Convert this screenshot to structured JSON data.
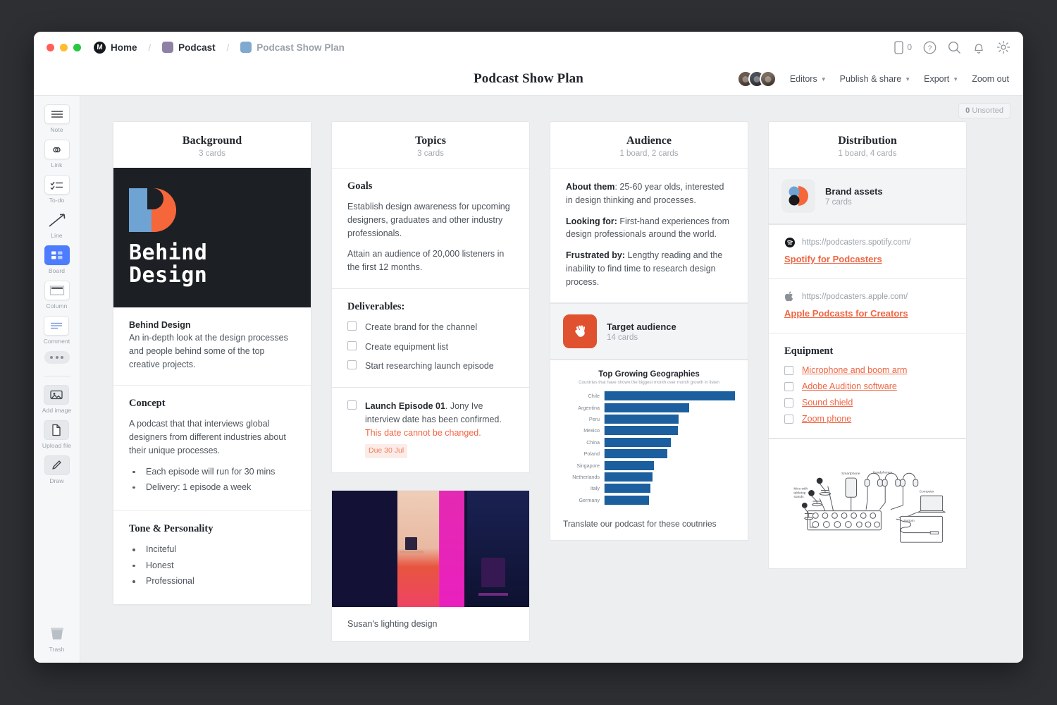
{
  "titlebar": {
    "breadcrumb": [
      {
        "label": "Home",
        "icon": "milanote-logo-icon"
      },
      {
        "label": "Podcast",
        "icon": "purple-board-icon"
      },
      {
        "label": "Podcast Show Plan",
        "icon": "blue-board-icon"
      }
    ],
    "separator": "/",
    "mobile_count": "0",
    "icons": [
      "mobile-icon",
      "help-icon",
      "search-icon",
      "notification-icon",
      "settings-icon"
    ]
  },
  "header": {
    "title": "Podcast Show Plan",
    "editors_label": "Editors",
    "publish_label": "Publish & share",
    "export_label": "Export",
    "zoom_label": "Zoom out"
  },
  "sidebar": {
    "items": [
      {
        "label": "Note",
        "icon": "note-icon"
      },
      {
        "label": "Link",
        "icon": "link-icon"
      },
      {
        "label": "To-do",
        "icon": "todo-icon"
      },
      {
        "label": "Line",
        "icon": "line-icon"
      },
      {
        "label": "Board",
        "icon": "board-icon"
      },
      {
        "label": "Column",
        "icon": "column-icon"
      },
      {
        "label": "Comment",
        "icon": "comment-icon"
      }
    ],
    "more_icon": "more-dots-icon",
    "file_items": [
      {
        "label": "Add image",
        "icon": "add-image-icon"
      },
      {
        "label": "Upload file",
        "icon": "upload-file-icon"
      },
      {
        "label": "Draw",
        "icon": "draw-icon"
      }
    ],
    "trash": {
      "label": "Trash",
      "icon": "trash-icon"
    }
  },
  "canvas": {
    "unsorted_count": "0",
    "unsorted_label": "Unsorted"
  },
  "columns": [
    {
      "title": "Background",
      "subtitle": "3 cards",
      "brand_image": {
        "wordmark_line1": "Behind",
        "wordmark_line2": "Design",
        "bg_color": "#1c2024",
        "blue": "#6ea3d4",
        "orange": "#f5673b"
      },
      "cards": [
        {
          "heading": "Behind Design",
          "body": "An in-depth look at the design processes and people behind some of the top creative projects."
        },
        {
          "title": "Concept",
          "body": "A podcast that that interviews global designers from different industries about their unique processes.",
          "bullets": [
            "Each episode will run for 30 mins",
            "Delivery: 1 episode a week"
          ]
        },
        {
          "title": "Tone & Personality",
          "bullets": [
            "Inciteful",
            "Honest",
            "Professional"
          ]
        }
      ]
    },
    {
      "title": "Topics",
      "subtitle": "3 cards",
      "goals": {
        "title": "Goals",
        "p1": "Establish design awareness for upcoming designers, graduates and other industry professionals.",
        "p2": "Attain an audience of 20,000 listeners in the first 12 months."
      },
      "deliverables": {
        "title": "Deliverables:",
        "items": [
          "Create brand for the channel",
          "Create equipment list",
          "Start researching launch episode"
        ]
      },
      "launch": {
        "bold": "Launch Episode 01",
        "rest": ". Jony Ive interview date has been confirmed.",
        "warning": "This date cannot be changed.",
        "due": "Due 30 Jul"
      },
      "photo_caption": "Susan's lighting design"
    },
    {
      "title": "Audience",
      "subtitle": "1 board, 2 cards",
      "about": [
        {
          "label": "About them",
          "sep": ": ",
          "text": "25-60 year olds, interested in design thinking and processes."
        },
        {
          "label": "Looking for:",
          "sep": " ",
          "text": "First-hand experiences from design professionals around the world."
        },
        {
          "label": "Frustrated by:",
          "sep": " ",
          "text": "Lengthy reading and the inability to find time to research design process."
        }
      ],
      "board": {
        "name": "Target audience",
        "sub": "14 cards",
        "icon": "clapping-hands-icon",
        "color": "#e0522f"
      },
      "chart_note": "Translate our podcast for these coutnries"
    },
    {
      "title": "Distribution",
      "subtitle": "1 board, 4 cards",
      "board": {
        "name": "Brand assets",
        "sub": "7 cards",
        "icon": "brand-assets-icon"
      },
      "links": [
        {
          "url": "https://podcasters.spotify.com/",
          "title": "Spotify for Podcasters",
          "icon": "spotify-icon"
        },
        {
          "url": "https://podcasters.apple.com/",
          "title": "Apple Podcasts for Creators",
          "icon": "apple-icon"
        }
      ],
      "equipment": {
        "title": "Equipment",
        "items": [
          "Microphone and boom arm",
          "Adobe Audition software",
          "Sound shield",
          "Zoom phone"
        ]
      },
      "diagram_labels": {
        "mics": "Mics with tabletop stands",
        "smartphone": "Smartphone",
        "headphones": "Headphones",
        "computer": "Computer",
        "bottom": "Bottom"
      }
    }
  ],
  "chart_data": {
    "type": "bar",
    "orientation": "horizontal",
    "title": "Top Growing Geographies",
    "subtitle": "Countries that have shown the biggest month over month growth in listen",
    "categories": [
      "Chile",
      "Argentina",
      "Peru",
      "Mexico",
      "China",
      "Poland",
      "Singapore",
      "Netherlands",
      "Italy",
      "Germany"
    ],
    "values": [
      100,
      65,
      57,
      56,
      51,
      48,
      38,
      37,
      35,
      34
    ],
    "xlabel": "",
    "ylabel": "",
    "xlim": [
      0,
      100
    ],
    "grid": false,
    "legend": false,
    "bar_color": "#1b5f9e"
  }
}
